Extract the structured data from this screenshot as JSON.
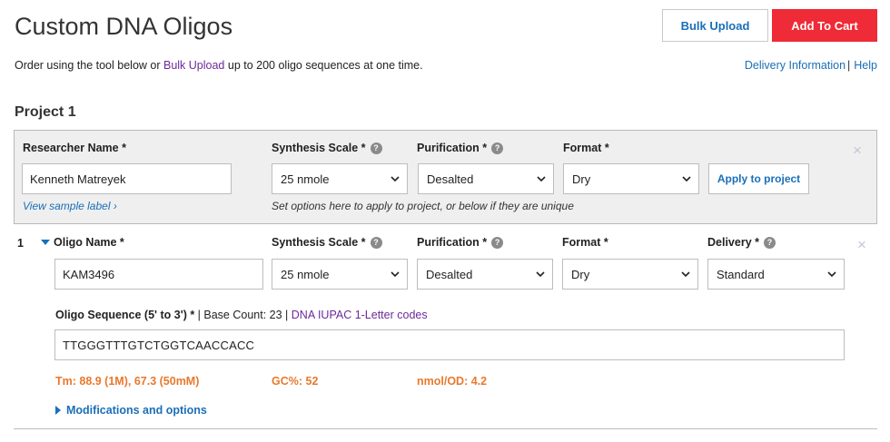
{
  "page": {
    "title": "Custom DNA Oligos",
    "bulk_upload_btn": "Bulk Upload",
    "add_to_cart_btn": "Add To Cart",
    "intro_prefix": "Order using the tool below or ",
    "intro_link": "Bulk Upload",
    "intro_suffix": " up to 200 oligo sequences at one time.",
    "delivery_info_link": "Delivery Information",
    "separator": "|",
    "help_link": "Help"
  },
  "project": {
    "title": "Project 1",
    "researcher_label": "Researcher Name *",
    "researcher_value": "Kenneth Matreyek",
    "synthesis_label": "Synthesis Scale *",
    "synthesis_value": "25 nmole",
    "purification_label": "Purification *",
    "purification_value": "Desalted",
    "format_label": "Format *",
    "format_value": "Dry",
    "apply_btn": "Apply to project",
    "sample_label_link": "View sample label ›",
    "hint": "Set options here to apply to project, or below if they are unique",
    "close_glyph": "×",
    "help_glyph": "?"
  },
  "oligo": {
    "number": "1",
    "name_label": "Oligo Name *",
    "name_value": "KAM3496",
    "synthesis_label": "Synthesis Scale *",
    "synthesis_value": "25 nmole",
    "purification_label": "Purification *",
    "purification_value": "Desalted",
    "format_label": "Format *",
    "format_value": "Dry",
    "delivery_label": "Delivery *",
    "delivery_value": "Standard",
    "close_glyph": "×",
    "help_glyph": "?",
    "sequence_label": "Oligo Sequence (5' to 3') *",
    "base_count": " | Base Count: 23 | ",
    "iupac_link": "DNA IUPAC 1-Letter codes",
    "sequence_value": "TTGGGTTTGTCTGGTCAACCACC",
    "tm": "Tm: 88.9 (1M), 67.3 (50mM)",
    "gc": "GC%: 52",
    "nmol_od": "nmol/OD: 4.2",
    "modifications_link": "Modifications and options"
  },
  "colors": {
    "accent_blue": "#1a6fb8",
    "cart_red": "#ee2b36",
    "link_purple": "#6d2a9a",
    "stat_orange": "#e8792d"
  }
}
